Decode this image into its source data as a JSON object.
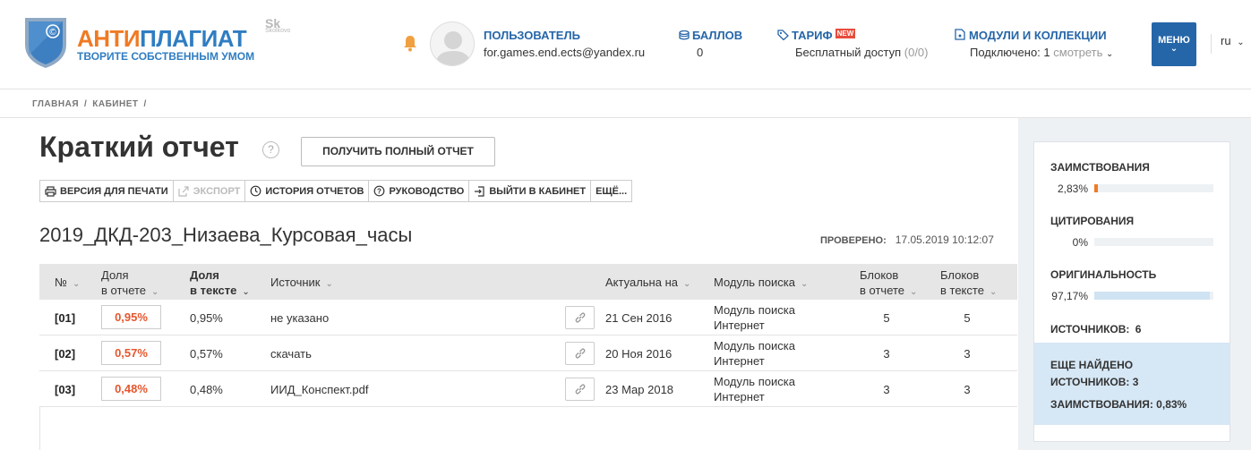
{
  "brand": {
    "name_a": "АНТИ",
    "name_b": "ПЛАГИАТ",
    "tagline": "ТВОРИТЕ СОБСТВЕННЫМ УМОМ",
    "partner": "Sk",
    "partner_sub": "Skolkovo",
    "shield_symbol": "©"
  },
  "header": {
    "user_label": "ПОЛЬЗОВАТЕЛЬ",
    "user_email": "for.games.end.ects@yandex.ru",
    "balls_label": "БАЛЛОВ",
    "balls_value": "0",
    "tarif_label": "ТАРИФ",
    "tarif_badge": "NEW",
    "tarif_value": "Бесплатный доступ",
    "tarif_count": "(0/0)",
    "modules_label": "МОДУЛИ И КОЛЛЕКЦИИ",
    "modules_value": "Подключено: 1",
    "modules_link": "смотреть",
    "menu_label": "МЕНЮ",
    "lang": "ru"
  },
  "breadcrumb": [
    "ГЛАВНАЯ",
    "/",
    "КАБИНЕТ",
    "/"
  ],
  "page": {
    "title": "Краткий отчет",
    "help": "?",
    "full_report_button": "ПОЛУЧИТЬ ПОЛНЫЙ ОТЧЕТ",
    "toolbar": {
      "print": "ВЕРСИЯ ДЛЯ ПЕЧАТИ",
      "export": "ЭКСПОРТ",
      "history": "ИСТОРИЯ ОТЧЕТОВ",
      "guide": "РУКОВОДСТВО",
      "exit": "ВЫЙТИ В КАБИНЕТ",
      "more": "ЕЩЁ..."
    },
    "document_name": "2019_ДКД-203_Низаева_Курсовая_часы",
    "checked_label": "ПРОВЕРЕНО:",
    "checked_value": "17.05.2019 10:12:07"
  },
  "table": {
    "headers": {
      "num": "№",
      "share_report_1": "Доля",
      "share_report_2": "в отчете",
      "share_text_1": "Доля",
      "share_text_2": "в тексте",
      "source": "Источник",
      "actual": "Актуальна на",
      "module": "Модуль поиска",
      "blocks_report_1": "Блоков",
      "blocks_report_2": "в отчете",
      "blocks_text_1": "Блоков",
      "blocks_text_2": "в тексте"
    },
    "rows": [
      {
        "num": "[01]",
        "share_report": "0,95%",
        "share_text": "0,95%",
        "source": "не указано",
        "date": "21 Сен 2016",
        "module": "Модуль поиска Интернет",
        "blocks_report": "5",
        "blocks_text": "5"
      },
      {
        "num": "[02]",
        "share_report": "0,57%",
        "share_text": "0,57%",
        "source": "скачать",
        "date": "20 Ноя 2016",
        "module": "Модуль поиска Интернет",
        "blocks_report": "3",
        "blocks_text": "3"
      },
      {
        "num": "[03]",
        "share_report": "0,48%",
        "share_text": "0,48%",
        "source": "ИИД_Конспект.pdf",
        "date": "23 Мар 2018",
        "module": "Модуль поиска Интернет",
        "blocks_report": "3",
        "blocks_text": "3"
      }
    ]
  },
  "sidebar": {
    "borrowing_label": "ЗАИМСТВОВАНИЯ",
    "borrowing_pct": "2,83%",
    "borrowing_value": 0.0283,
    "citing_label": "ЦИТИРОВАНИЯ",
    "citing_pct": "0%",
    "citing_value": 0,
    "original_label": "ОРИГИНАЛЬНОСТЬ",
    "original_pct": "97,17%",
    "original_value": 0.9717,
    "sources_label": "ИСТОЧНИКОВ:",
    "sources_count": "6",
    "more_found": "ЕЩЕ НАЙДЕНО ИСТОЧНИКОВ: 3",
    "more_borrowing": "ЗАИМСТВОВАНИЯ: 0,83%",
    "colors": {
      "borrowing": "#f07a24",
      "citing": "#4caf50",
      "original": "#cfe3f3"
    }
  },
  "colors": {
    "accent": "#2566a8",
    "orange": "#f07a24",
    "danger": "#e5562e"
  }
}
